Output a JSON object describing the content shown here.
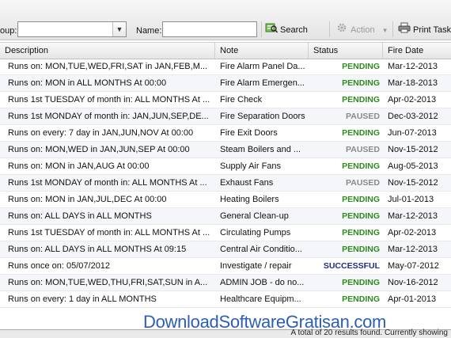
{
  "toolbar": {
    "group_label": "oup:",
    "group_value": "",
    "name_label": "Name:",
    "name_value": "",
    "search_label": "Search",
    "action_label": "Action",
    "print_label": "Print Tasks"
  },
  "table": {
    "columns": [
      "Description",
      "Note",
      "Status",
      "Fire Date"
    ],
    "rows": [
      {
        "desc": "Runs on: MON,TUE,WED,FRI,SAT in JAN,FEB,M...",
        "note": "Fire Alarm Panel Da...",
        "status": "PENDING",
        "date": "Mar-12-2013"
      },
      {
        "desc": "Runs on: MON in ALL MONTHS At 00:00",
        "note": "Fire Alarm Emergen...",
        "status": "PENDING",
        "date": "Mar-18-2013"
      },
      {
        "desc": "Runs 1st TUESDAY of month in: ALL MONTHS At ...",
        "note": "Fire Check",
        "status": "PENDING",
        "date": "Apr-02-2013"
      },
      {
        "desc": "Runs 1st MONDAY of month in: JAN,JUN,SEP,DE...",
        "note": "Fire Separation Doors",
        "status": "PAUSED",
        "date": "Dec-03-2012"
      },
      {
        "desc": "Runs on every: 7 day in JAN,JUN,NOV At 00:00",
        "note": "Fire Exit Doors",
        "status": "PENDING",
        "date": "Jun-07-2013"
      },
      {
        "desc": "Runs on: MON,WED in JAN,JUN,SEP At 00:00",
        "note": "Steam Boilers and ...",
        "status": "PAUSED",
        "date": "Nov-15-2012"
      },
      {
        "desc": "Runs on: MON in JAN,AUG At 00:00",
        "note": "Supply Air Fans",
        "status": "PENDING",
        "date": "Aug-05-2013"
      },
      {
        "desc": "Runs 1st MONDAY of month in: ALL MONTHS At ...",
        "note": "Exhaust Fans",
        "status": "PAUSED",
        "date": "Nov-15-2012"
      },
      {
        "desc": "Runs on: MON in JAN,JUL,DEC At 00:00",
        "note": "Heating Boilers",
        "status": "PENDING",
        "date": "Jul-01-2013"
      },
      {
        "desc": "Runs on: ALL DAYS in ALL MONTHS",
        "note": "General Clean-up",
        "status": "PENDING",
        "date": "Mar-12-2013"
      },
      {
        "desc": "Runs 1st TUESDAY of month in: ALL MONTHS At ...",
        "note": "Circulating Pumps",
        "status": "PENDING",
        "date": "Apr-02-2013"
      },
      {
        "desc": "Runs on: ALL DAYS in ALL MONTHS At 09:15",
        "note": "Central Air Conditio...",
        "status": "PENDING",
        "date": "Mar-12-2013"
      },
      {
        "desc": "Runs once on: 05/07/2012",
        "note": "Investigate / repair",
        "status": "SUCCESSFUL",
        "date": "May-07-2012"
      },
      {
        "desc": "Runs on: MON,TUE,WED,THU,FRI,SAT,SUN in A...",
        "note": "ADMIN JOB - do no...",
        "status": "PENDING",
        "date": "Nov-16-2012"
      },
      {
        "desc": "Runs on every: 1 day in ALL MONTHS",
        "note": "Healthcare Equipm...",
        "status": "PENDING",
        "date": "Apr-01-2013"
      }
    ]
  },
  "footer": {
    "summary": "A total of 20 results found. Currently showing"
  },
  "watermark": "DownloadSoftwareGratisan.com",
  "colors": {
    "pending": "#2e8b1e",
    "paused": "#8a8a8a",
    "successful": "#1d2f7d",
    "watermark": "#2b5fb3"
  }
}
